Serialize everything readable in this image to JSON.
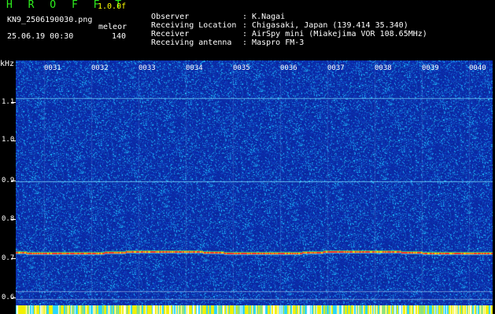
{
  "app": {
    "name": "H R O F F T",
    "version": "1.0.0f",
    "file": "KN9_2506190030.png",
    "mode": "meleor",
    "date_time": "25.06.19 00:30",
    "count": "140"
  },
  "info": [
    {
      "label": "Observer",
      "value": "K.Nagai"
    },
    {
      "label": "Receiving Location",
      "value": "Chigasaki, Japan (139.414 35.340)"
    },
    {
      "label": "Receiver",
      "value": "AirSpy mini (Miakejima VOR 108.65MHz)"
    },
    {
      "label": "Receiving antenna",
      "value": "Maspro FM-3"
    }
  ],
  "spectrogram": {
    "y_unit": "kHz",
    "y_labels": [
      "1.1",
      "1.0",
      "0.9",
      "0.8",
      "0.7",
      "0.6"
    ],
    "x_labels": [
      "0031",
      "0032",
      "0033",
      "0034",
      "0035",
      "0036",
      "0037",
      "0038",
      "0039",
      "0040"
    ],
    "colors": {
      "background": "#0a2c9a",
      "noise": "#18c8ff",
      "carrier": "#ff2020",
      "label": "#ffffff"
    }
  }
}
